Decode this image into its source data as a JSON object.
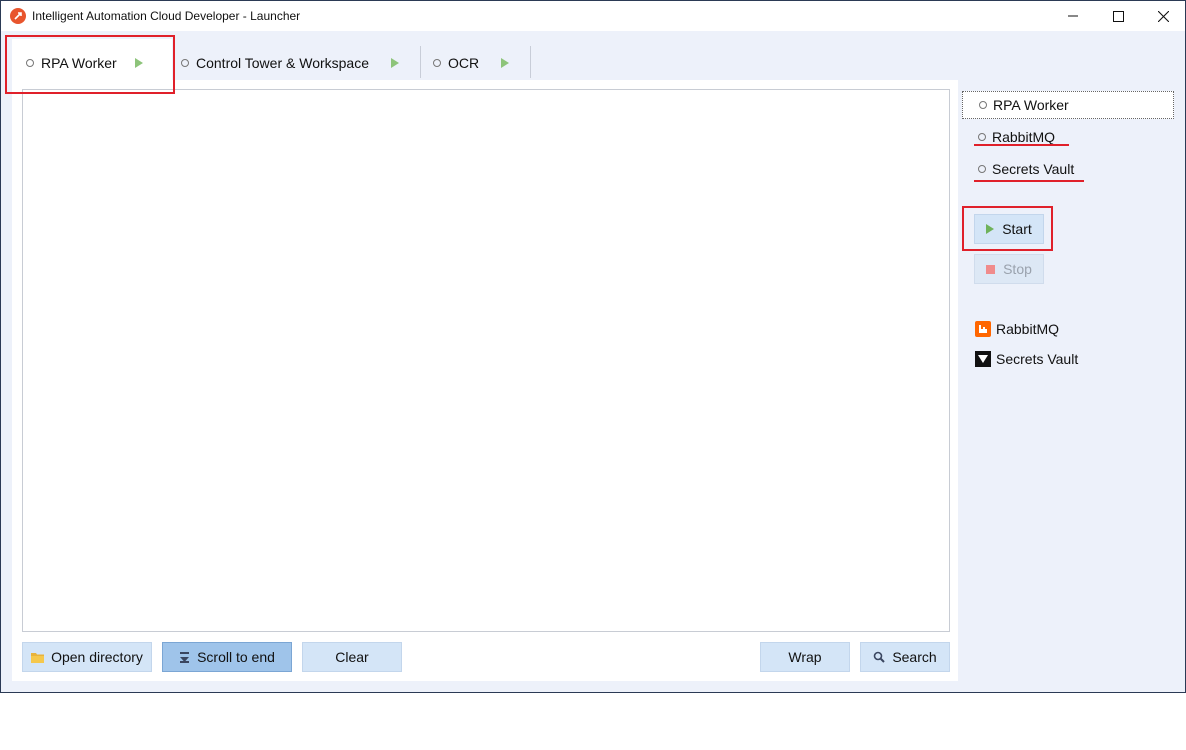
{
  "window": {
    "title": "Intelligent Automation Cloud Developer - Launcher"
  },
  "tabs": [
    {
      "label": "RPA Worker",
      "active": true
    },
    {
      "label": "Control Tower & Workspace",
      "active": false
    },
    {
      "label": "OCR",
      "active": false
    }
  ],
  "log": {
    "buttons": {
      "open_directory": "Open directory",
      "scroll_to_end": "Scroll to end",
      "clear": "Clear",
      "wrap": "Wrap",
      "search": "Search"
    }
  },
  "side": {
    "services": [
      {
        "label": "RPA Worker",
        "selected": true
      },
      {
        "label": "RabbitMQ",
        "selected": false
      },
      {
        "label": "Secrets Vault",
        "selected": false
      }
    ],
    "start_label": "Start",
    "stop_label": "Stop",
    "links": [
      {
        "label": "RabbitMQ",
        "icon": "rabbitmq-icon"
      },
      {
        "label": "Secrets Vault",
        "icon": "vault-icon"
      }
    ]
  },
  "colors": {
    "highlight": "#e0202a",
    "accent_button": "#9fc4ea",
    "button": "#d4e5f7",
    "play_green": "#6fb25a",
    "stop_red": "#f08b8b"
  }
}
